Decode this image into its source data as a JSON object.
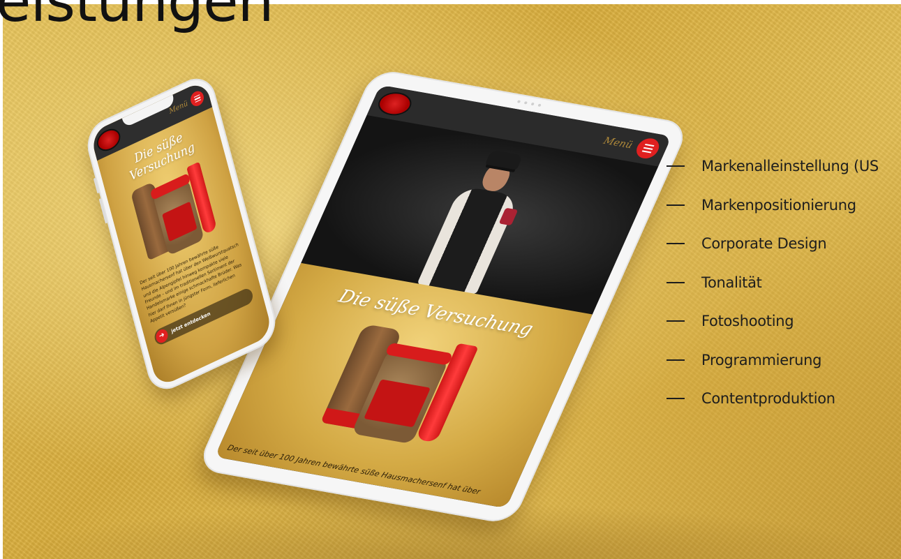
{
  "heading": "eistungen",
  "services": [
    "Markenalleinstellung (US",
    "Markenpositionierung",
    "Corporate Design",
    "Tonalität",
    "Fotoshooting",
    "Programmierung",
    "Contentproduktion"
  ],
  "colors": {
    "gold_background": "#dcb24a",
    "brand_red": "#e02020",
    "nav_dark": "#2b2b2b",
    "text_dark": "#1d1d1d"
  },
  "tablet": {
    "menu_label": "Menü",
    "menu_icon": "hamburger-icon",
    "headline": "Die süße Versuchung",
    "body_text": "Der seit über 100 Jahren bewährte süße Hausmachersenf hat über"
  },
  "phone": {
    "menu_label": "Menü",
    "menu_icon": "hamburger-icon",
    "headline_line1": "Die süße",
    "headline_line2": "Versuchung",
    "body_text": "Der seit über 100 Jahren bewährte süße Hausmachersenf hat über den Weißwurstquatsch und die Alpengipfel hinweg kompakte viele Freunde – und im traditionellen Sortiment der Handelsmarke einige schmackhafte Brüder. Was hier darf Ihnen in jüngster Form, lieferlichen Appetit versüßen?",
    "cta_label": "jetzt entdecken",
    "cta_icon": "arrow-right-icon"
  }
}
